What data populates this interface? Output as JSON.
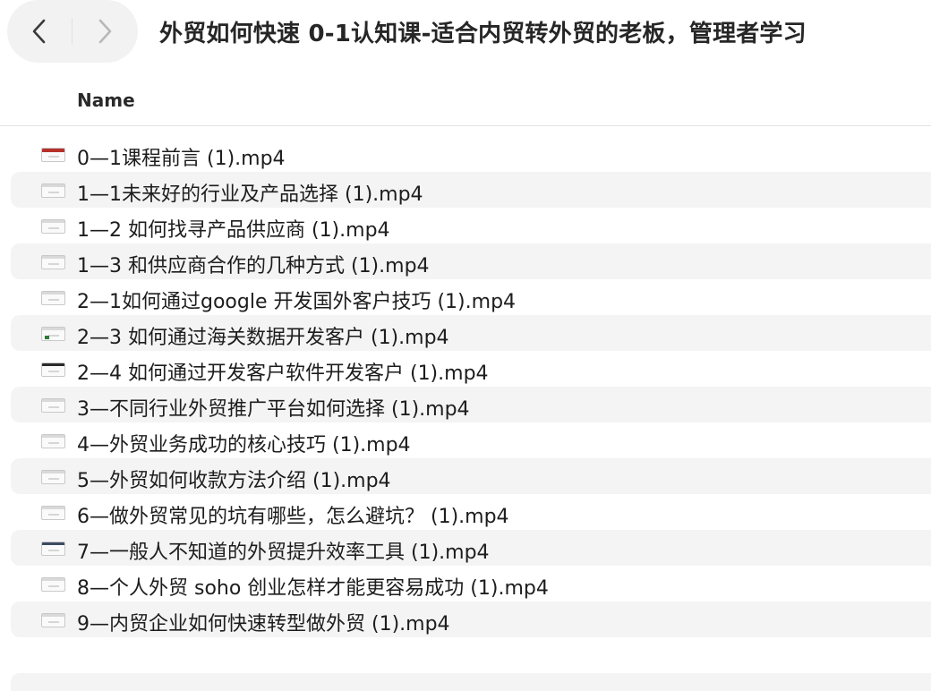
{
  "window": {
    "title": "外贸如何快速 0-1认知课-适合内贸转外贸的老板，管理者学习"
  },
  "nav": {
    "back_icon": "chevron-left-icon",
    "forward_icon": "chevron-right-icon"
  },
  "list": {
    "column_name": "Name",
    "files": [
      {
        "name": "0—1课程前言 (1).mp4",
        "thumb": "red"
      },
      {
        "name": "1—1未来好的行业及产品选择 (1).mp4",
        "thumb": "plain"
      },
      {
        "name": "1—2 如何找寻产品供应商 (1).mp4",
        "thumb": "plain"
      },
      {
        "name": "1—3 和供应商合作的几种方式 (1).mp4",
        "thumb": "plain"
      },
      {
        "name": "2—1如何通过google 开发国外客户技巧 (1).mp4",
        "thumb": "plain"
      },
      {
        "name": "2—3 如何通过海关数据开发客户 (1).mp4",
        "thumb": "green"
      },
      {
        "name": "2—4 如何通过开发客户软件开发客户 (1).mp4",
        "thumb": "dark"
      },
      {
        "name": "3—不同行业外贸推广平台如何选择 (1).mp4",
        "thumb": "plain"
      },
      {
        "name": "4—外贸业务成功的核心技巧 (1).mp4",
        "thumb": "plain"
      },
      {
        "name": "5—外贸如何收款方法介绍 (1).mp4",
        "thumb": "plain"
      },
      {
        "name": "6—做外贸常见的坑有哪些，怎么避坑？ (1).mp4",
        "thumb": "plain"
      },
      {
        "name": "7—一般人不知道的外贸提升效率工具 (1).mp4",
        "thumb": "navy"
      },
      {
        "name": "8—个人外贸 soho 创业怎样才能更容易成功 (1).mp4",
        "thumb": "plain"
      },
      {
        "name": "9—内贸企业如何快速转型做外贸 (1).mp4",
        "thumb": "plain"
      }
    ]
  }
}
